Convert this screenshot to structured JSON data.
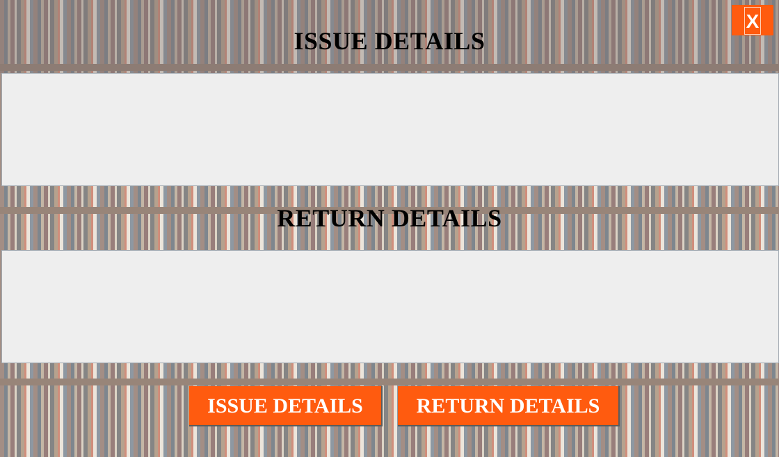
{
  "close_button": {
    "label": "X"
  },
  "issue_section": {
    "title": "ISSUE DETAILS"
  },
  "return_section": {
    "title": "RETURN DETAILS"
  },
  "footer_buttons": {
    "issue_label": "ISSUE DETAILS",
    "return_label": "RETURN DETAILS"
  },
  "colors": {
    "accent": "#ff5b0f",
    "panel": "#eeeeee"
  }
}
